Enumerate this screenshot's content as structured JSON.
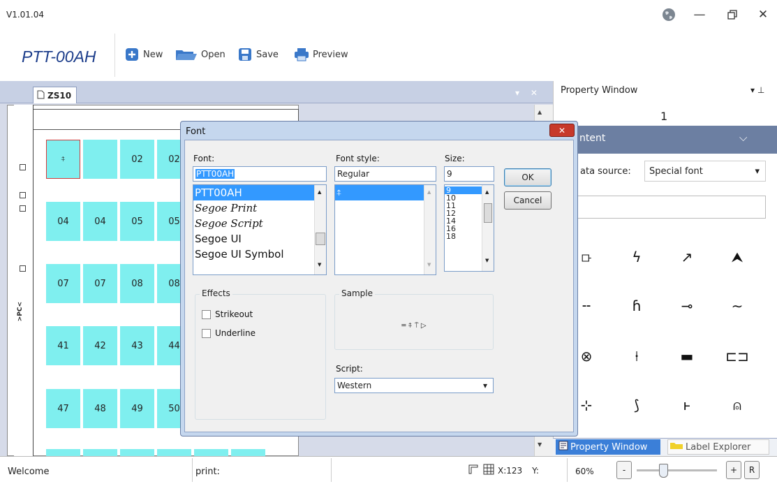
{
  "app": {
    "version": "V1.01.04",
    "title": "PTT-00AH"
  },
  "window_controls": {
    "globe": "globe-icon",
    "minimize": "—",
    "restore": "🗗",
    "close": "✕"
  },
  "toolbar": {
    "new": "New",
    "open": "Open",
    "save": "Save",
    "preview": "Preview"
  },
  "document": {
    "tab": "ZS10",
    "tab_controls": "▾ ✕",
    "side_label": ">PC<"
  },
  "grid": {
    "rows": [
      [
        "⍏",
        "",
        "02",
        "02"
      ],
      [
        "04",
        "04",
        "05",
        "05"
      ],
      [
        "07",
        "07",
        "08",
        "08"
      ],
      [
        "41",
        "42",
        "43",
        "44"
      ],
      [
        "47",
        "48",
        "49",
        "50"
      ]
    ]
  },
  "property_window": {
    "title": "Property Window",
    "pin": "▾ ⊥",
    "number": "1",
    "content_header": "ntent",
    "data_source_label": "ata source:",
    "data_source_value": "Special font",
    "symbols": [
      "⟥",
      "ϟ",
      "↗",
      "⮝",
      "╌",
      "ɦ",
      "⊸",
      "∼",
      "⊗",
      "⍿",
      "▬",
      "⊏⊐",
      "⊹",
      "⟆",
      "ⱶ",
      "⍝"
    ]
  },
  "bottom_tabs": {
    "property": "Property Window",
    "explorer": "Label Explorer"
  },
  "status": {
    "welcome": "Welcome",
    "print": "print:",
    "x": "X:123",
    "y": "Y:",
    "zoom": "60%",
    "minus": "-",
    "plus": "+",
    "reset": "R"
  },
  "font_dialog": {
    "title": "Font",
    "close": "✕",
    "font_label": "Font:",
    "font_value": "PTT00AH",
    "fonts": [
      "PTT00AH",
      "Segoe Print",
      "Segoe Script",
      "Segoe UI",
      "Segoe UI Symbol"
    ],
    "style_label": "Font style:",
    "style_value": "Regular",
    "styles": [
      "⍏"
    ],
    "size_label": "Size:",
    "size_value": "9",
    "sizes": [
      "9",
      "10",
      "11",
      "12",
      "14",
      "16",
      "18"
    ],
    "ok": "OK",
    "cancel": "Cancel",
    "effects_label": "Effects",
    "strikeout": "Strikeout",
    "underline": "Underline",
    "sample_label": "Sample",
    "sample_text": "═ ⍏ ⍑ ▷",
    "script_label": "Script:",
    "script_value": "Western"
  },
  "colors": {
    "accent": "#1b3c8a",
    "cell": "#7fefef",
    "selection": "#3399ff",
    "header": "#6c7fa2"
  }
}
